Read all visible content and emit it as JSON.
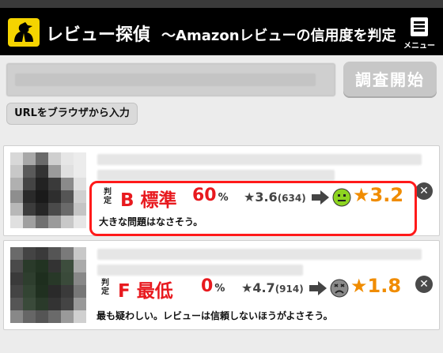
{
  "header": {
    "logo_icon": "detective-silhouette-icon",
    "title": "レビュー探偵",
    "subtitle": "〜Amazonレビューの信用度を判定",
    "menu_label": "メニュー",
    "menu_icon": "menu-document-icon"
  },
  "search": {
    "url_value": "",
    "submit_label": "調査開始",
    "browser_button_label": "URLをブラウザから入力"
  },
  "colors": {
    "header_bg": "#000000",
    "accent_red": "#e8191e",
    "adjusted_orange": "#f08c00",
    "highlight_border": "#ff1a1a",
    "face_green": "#8dd420",
    "face_gray": "#8a8a8a"
  },
  "results": [
    {
      "hantei_label": "判定",
      "grade_letter": "B",
      "grade_text": "標準",
      "percent": "60",
      "percent_unit": "%",
      "original_rating": "★3.6",
      "review_count": "(634)",
      "face_icon": "neutral-face-icon",
      "adjusted_rating": "★3.2",
      "comment": "大きな問題はなさそう。",
      "highlighted": true
    },
    {
      "hantei_label": "判定",
      "grade_letter": "F",
      "grade_text": "最低",
      "percent": "0",
      "percent_unit": "%",
      "original_rating": "★4.7",
      "review_count": "(914)",
      "face_icon": "disappointed-face-icon",
      "adjusted_rating": "★1.8",
      "comment": "最も疑わしい。レビューは信頼しないほうがよさそう。",
      "highlighted": false
    }
  ]
}
